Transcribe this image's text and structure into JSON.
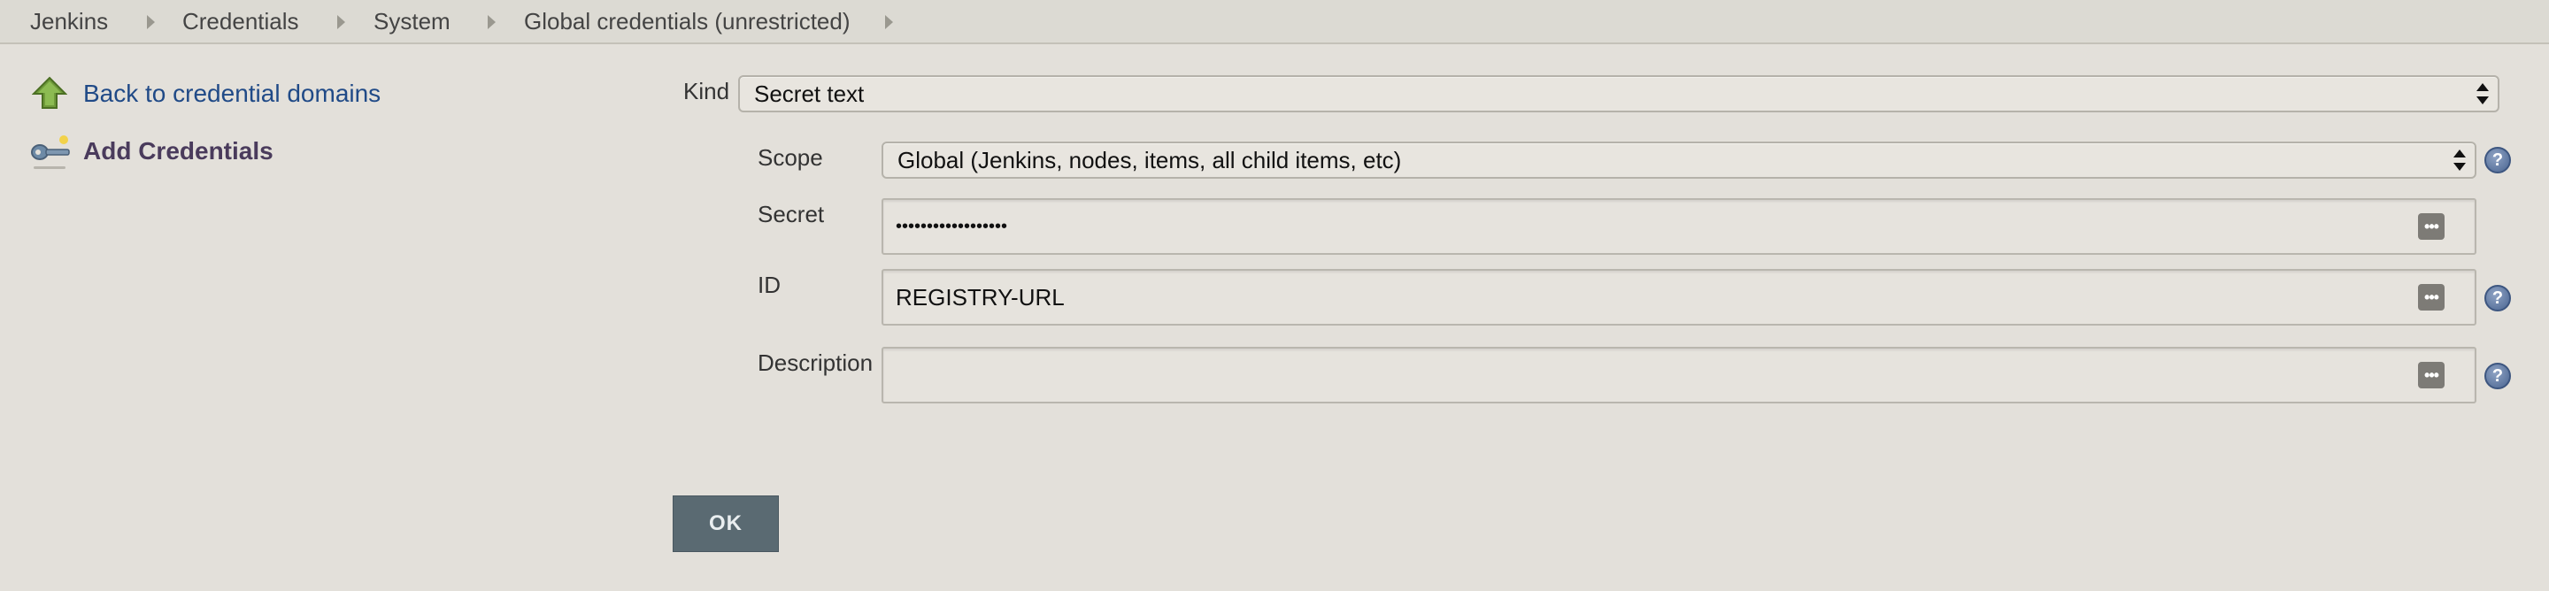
{
  "breadcrumb": {
    "items": [
      "Jenkins",
      "Credentials",
      "System",
      "Global credentials (unrestricted)"
    ]
  },
  "sidebar": {
    "back_label": "Back to credential domains",
    "add_label": "Add Credentials",
    "back_icon": "up-arrow-icon",
    "add_icon": "key-icon"
  },
  "form": {
    "kind_label": "Kind",
    "kind_value": "Secret text",
    "scope_label": "Scope",
    "scope_value": "Global (Jenkins, nodes, items, all child items, etc)",
    "secret_label": "Secret",
    "secret_value": "••••••••••••••••••",
    "id_label": "ID",
    "id_value": "REGISTRY-URL",
    "description_label": "Description",
    "description_value": "",
    "field_button": "•••",
    "help_glyph": "?"
  },
  "ok_label": "OK",
  "colors": {
    "background": "#e3e0da",
    "link": "#204a87",
    "ok_button": "#5a6a72"
  }
}
